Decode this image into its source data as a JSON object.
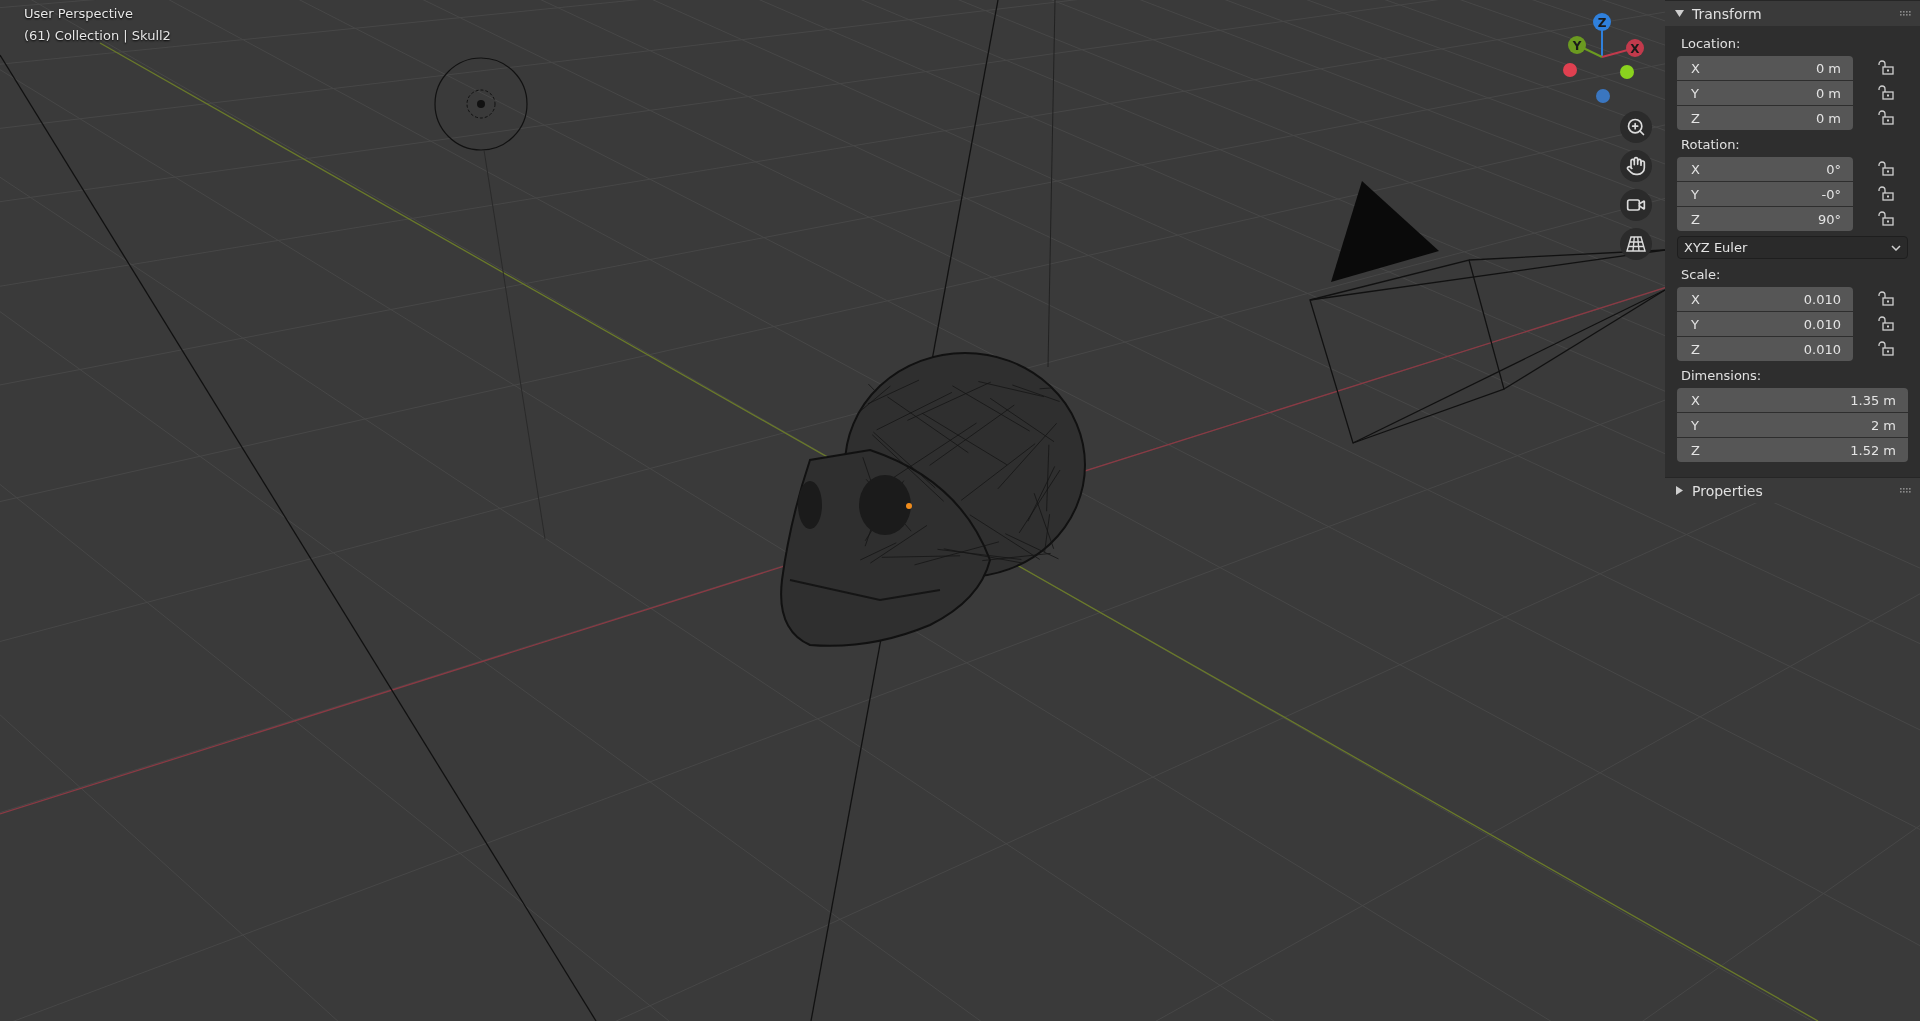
{
  "viewport": {
    "title": "User Perspective",
    "context": "(61) Collection | Skull2"
  },
  "gizmo": {
    "axes": [
      {
        "label": "Z",
        "color": "#2f80dc"
      },
      {
        "label": "Y",
        "color": "#6b9a20"
      },
      {
        "label": "X",
        "color": "#c23a4c"
      }
    ]
  },
  "sidebar": {
    "panels": [
      {
        "title": "Transform",
        "expanded": true,
        "groups": [
          {
            "label": "Location:",
            "fields": [
              {
                "axis": "X",
                "value": "0 m",
                "locked": false
              },
              {
                "axis": "Y",
                "value": "0 m",
                "locked": false
              },
              {
                "axis": "Z",
                "value": "0 m",
                "locked": false
              }
            ]
          },
          {
            "label": "Rotation:",
            "fields": [
              {
                "axis": "X",
                "value": "0°",
                "locked": false
              },
              {
                "axis": "Y",
                "value": "-0°",
                "locked": false
              },
              {
                "axis": "Z",
                "value": "90°",
                "locked": false
              }
            ],
            "mode": "XYZ Euler"
          },
          {
            "label": "Scale:",
            "fields": [
              {
                "axis": "X",
                "value": "0.010",
                "locked": false
              },
              {
                "axis": "Y",
                "value": "0.010",
                "locked": false
              },
              {
                "axis": "Z",
                "value": "0.010",
                "locked": false
              }
            ]
          },
          {
            "label": "Dimensions:",
            "fields": [
              {
                "axis": "X",
                "value": "1.35 m"
              },
              {
                "axis": "Y",
                "value": "2 m"
              },
              {
                "axis": "Z",
                "value": "1.52 m"
              }
            ]
          }
        ]
      },
      {
        "title": "Properties",
        "expanded": false
      }
    ]
  }
}
